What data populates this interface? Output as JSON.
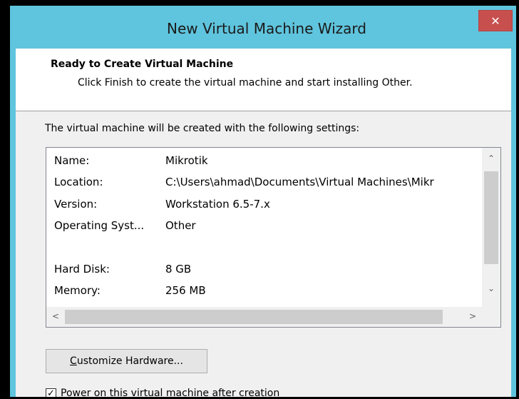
{
  "window": {
    "title": "New Virtual Machine Wizard",
    "close_glyph": "✕"
  },
  "header": {
    "title": "Ready to Create Virtual Machine",
    "subtitle": "Click Finish to create the virtual machine and start installing Other."
  },
  "intro": "The virtual machine will be created with the following settings:",
  "settings": [
    {
      "key": "Name:",
      "value": "Mikrotik"
    },
    {
      "key": "Location:",
      "value": "C:\\Users\\ahmad\\Documents\\Virtual Machines\\Mikr"
    },
    {
      "key": "Version:",
      "value": "Workstation 6.5-7.x"
    },
    {
      "key": "Operating Syst...",
      "value": "Other"
    },
    {
      "key": "Hard Disk:",
      "value": "8 GB"
    },
    {
      "key": "Memory:",
      "value": "256 MB"
    }
  ],
  "scroll": {
    "up": "⌃",
    "down": "⌄",
    "left": "<",
    "right": ">"
  },
  "customize_button": {
    "underlined": "C",
    "rest": "ustomize Hardware..."
  },
  "power_on": {
    "checked": true,
    "check_glyph": "✓",
    "label": "Power on this virtual machine after creation"
  }
}
